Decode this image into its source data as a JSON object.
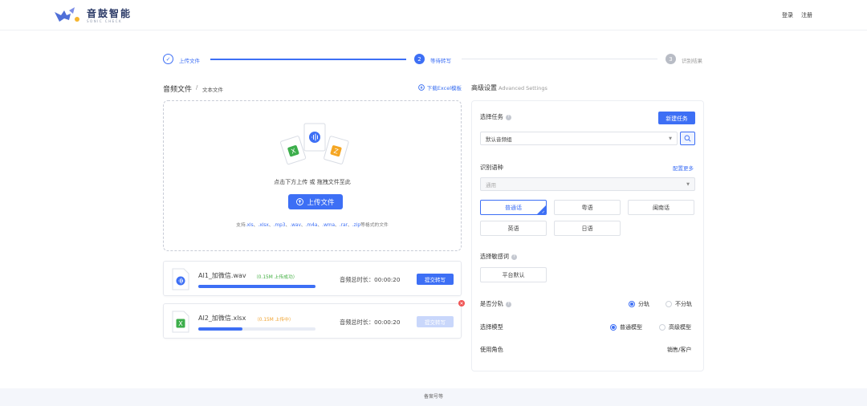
{
  "header": {
    "logo_cn": "音鼓智能",
    "logo_en": "SONIC CHECK",
    "login": "登录",
    "register": "注册"
  },
  "steps": [
    {
      "num": "✓",
      "label": "上传文件",
      "state": "done"
    },
    {
      "num": "2",
      "label": "等待转写",
      "state": "active"
    },
    {
      "num": "3",
      "label": "识别结果",
      "state": "pending"
    }
  ],
  "left": {
    "tab_audio": "音频文件",
    "tab_sep": "/",
    "tab_text": "文本文件",
    "download": "下载Excel模板",
    "upload_hint": "点击下方上传 或 拖拽文件至此",
    "upload_button": "上传文件",
    "support_prefix": "支持",
    "support_formats": [
      ".xls",
      ".xlsx",
      ".mp3",
      ".wav",
      ".m4a",
      ".wma",
      ".rar",
      ".zip"
    ],
    "support_suffix": "等格式的文件"
  },
  "files": [
    {
      "name": "AI1_加微信.wav",
      "size": "（0.15M 上传成功）",
      "size_color": "#3fae3f",
      "progress": 1.0,
      "duration": "音频总时长：00:00:20",
      "submit": "提交转写",
      "enabled": true,
      "type": "audio"
    },
    {
      "name": "AI2_加微信.xlsx",
      "size": "（0.15M 上传中）",
      "size_color": "#f0a12c",
      "progress": 0.38,
      "duration": "音频总时长：00:00:20",
      "submit": "提交转写",
      "enabled": false,
      "type": "excel"
    }
  ],
  "advanced": {
    "title": "高级设置",
    "title_en": "Advanced Settings",
    "select_task_label": "选择任务",
    "new_task": "新建任务",
    "task_value": "默认音频组",
    "lang_label": "识别语种",
    "config_more": "配置更多",
    "lang_select": "通用",
    "languages": [
      "普通话",
      "粤语",
      "闽南话",
      "英语",
      "日语"
    ],
    "active_language": "普通话",
    "sensitive_label": "选择敏感词",
    "sensitive_value": "平台默认",
    "split_label": "是否分轨",
    "split_yes": "分轨",
    "split_no": "不分轨",
    "model_label": "选择模型",
    "model_normal": "普通模型",
    "model_advanced": "高级模型",
    "role_label": "使用角色",
    "role_value": "销售/客户"
  },
  "footer": {
    "text": "备案号等"
  },
  "colors": {
    "accent": "#3d6ff5",
    "success": "#3fae3f",
    "warning": "#f0a12c",
    "danger": "#f05454"
  }
}
